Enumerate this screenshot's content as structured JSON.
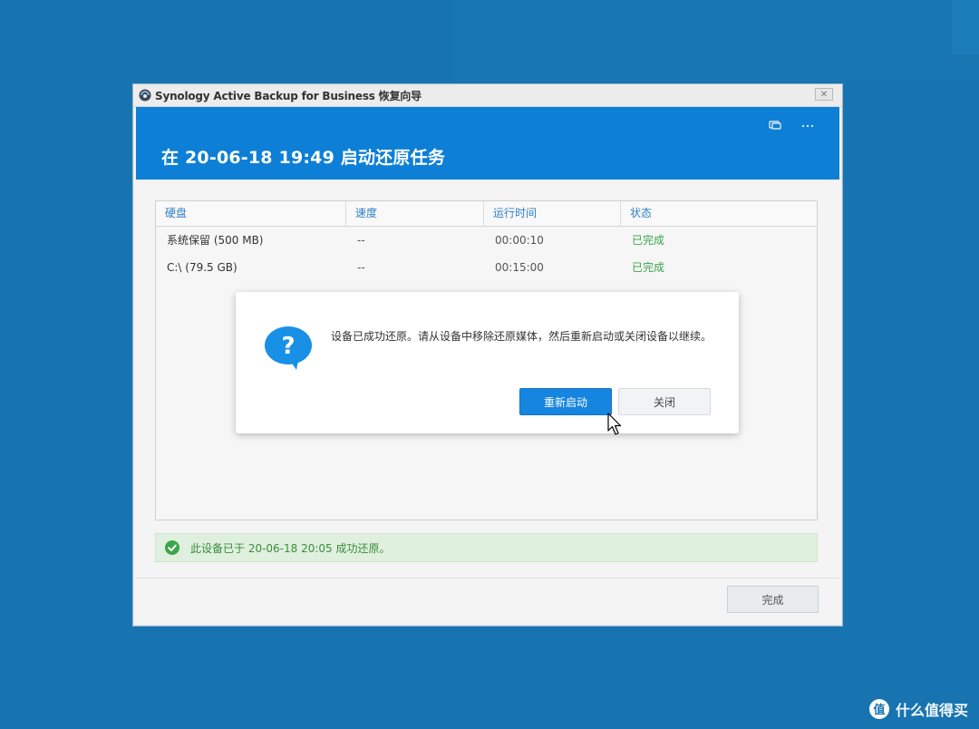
{
  "window": {
    "title": "Synology Active Backup for Business 恢复向导",
    "close_glyph": "✕"
  },
  "header": {
    "title": "在 20-06-18 19:49 启动还原任务"
  },
  "table": {
    "columns": [
      "硬盘",
      "速度",
      "运行时间",
      "状态"
    ],
    "rows": [
      {
        "disk": "系统保留 (500 MB)",
        "speed": "--",
        "runtime": "00:00:10",
        "status": "已完成"
      },
      {
        "disk": "C:\\ (79.5 GB)",
        "speed": "--",
        "runtime": "00:15:00",
        "status": "已完成"
      }
    ]
  },
  "dialog": {
    "message": "设备已成功还原。请从设备中移除还原媒体，然后重新启动或关闭设备以继续。",
    "restart_label": "重新启动",
    "close_label": "关闭"
  },
  "status": {
    "message": "此设备已于 20-06-18 20:05 成功还原。"
  },
  "footer": {
    "done_label": "完成"
  },
  "watermark": {
    "text": "什么值得买"
  },
  "colors": {
    "desktop": "#1774b0",
    "header": "#0e7fd6",
    "accent": "#1685e0",
    "success": "#3aa54a"
  }
}
